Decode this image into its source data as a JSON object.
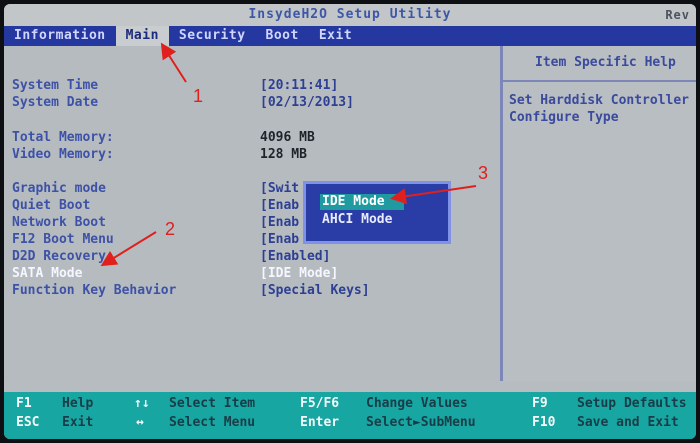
{
  "window": {
    "title": "InsydeH2O Setup Utility",
    "right_label": "Rev"
  },
  "menu": {
    "items": [
      "Information",
      "Main",
      "Security",
      "Boot",
      "Exit"
    ],
    "active_index": 1
  },
  "fields": {
    "system_time": {
      "label": "System Time",
      "value": "[20:11:41]"
    },
    "system_date": {
      "label": "System Date",
      "value": "[02/13/2013]"
    },
    "total_memory": {
      "label": "Total Memory:",
      "value": "4096 MB"
    },
    "video_memory": {
      "label": "Video Memory:",
      "value": "128 MB"
    },
    "graphic_mode": {
      "label": "Graphic mode",
      "value": "[Swit"
    },
    "quiet_boot": {
      "label": "Quiet Boot",
      "value": "[Enab"
    },
    "network_boot": {
      "label": "Network Boot",
      "value": "[Enab"
    },
    "f12_boot_menu": {
      "label": "F12 Boot Menu",
      "value": "[Enab"
    },
    "d2d_recovery": {
      "label": "D2D Recovery",
      "value": "[Enabled]"
    },
    "sata_mode": {
      "label": "SATA Mode",
      "value": "[IDE Mode]"
    },
    "function_key_behavior": {
      "label": "Function Key Behavior",
      "value": "[Special Keys]"
    }
  },
  "popup": {
    "options": [
      "IDE Mode",
      "AHCI Mode"
    ],
    "selected_index": 0
  },
  "help_panel": {
    "header": "Item Specific Help",
    "lines": [
      "Set Harddisk Controller",
      "Configure Type"
    ]
  },
  "footer": {
    "row1": [
      {
        "key": "F1",
        "desc": "Help"
      },
      {
        "key": "↑↓",
        "desc": "Select Item"
      },
      {
        "key": "F5/F6",
        "desc": "Change Values"
      },
      {
        "key": "F9",
        "desc": "Setup Defaults"
      }
    ],
    "row2": [
      {
        "key": "ESC",
        "desc": "Exit"
      },
      {
        "key": "↔",
        "desc": "Select Menu"
      },
      {
        "key": "Enter",
        "desc": "Select►SubMenu"
      },
      {
        "key": "F10",
        "desc": "Save and Exit"
      }
    ]
  },
  "annotations": [
    "1",
    "2",
    "3"
  ],
  "colors": {
    "menubar": "#2538a0",
    "panel": "#b6bbc0",
    "footer": "#18a6a2",
    "popup": "#2a3da6",
    "annotation": "#e0201c"
  }
}
